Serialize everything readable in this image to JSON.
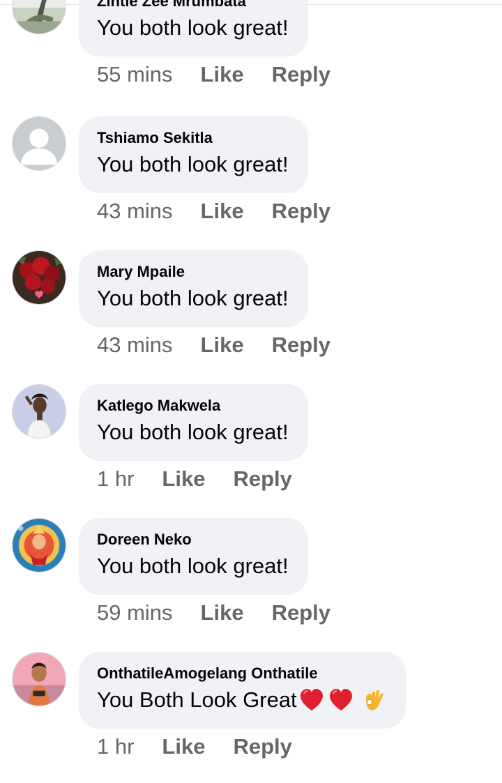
{
  "comments": [
    {
      "author": "Zintle Zee Mrumbata",
      "text": "You both look great!",
      "time": "55 mins",
      "like": "Like",
      "reply": "Reply",
      "avatar": "photo-plant-avatar"
    },
    {
      "author": "Tshiamo Sekitla",
      "text": "You both look great!",
      "time": "43 mins",
      "like": "Like",
      "reply": "Reply",
      "avatar": "default-user-avatar"
    },
    {
      "author": "Mary Mpaile",
      "text": "You both look great!",
      "time": "43 mins",
      "like": "Like",
      "reply": "Reply",
      "avatar": "photo-roses-avatar"
    },
    {
      "author": "Katlego Makwela",
      "text": "You both look great!",
      "time": "1 hr",
      "like": "Like",
      "reply": "Reply",
      "avatar": "photo-woman-avatar"
    },
    {
      "author": "Doreen Neko",
      "text": "You both look great!",
      "time": "59 mins",
      "like": "Like",
      "reply": "Reply",
      "avatar": "photo-deity-avatar"
    },
    {
      "author": "OnthatileAmogelang Onthatile",
      "text": "You Both Look Great",
      "emojis": [
        "red-heart-icon",
        "red-heart-icon",
        "ok-hand-icon"
      ],
      "time": "1 hr",
      "like": "Like",
      "reply": "Reply",
      "avatar": "photo-person-avatar"
    }
  ],
  "colors": {
    "bubble": "#f0f2f5",
    "meta_text": "#65676b",
    "text": "#050505",
    "heart": "#e0202e",
    "ok_hand": "#f5b62e"
  }
}
